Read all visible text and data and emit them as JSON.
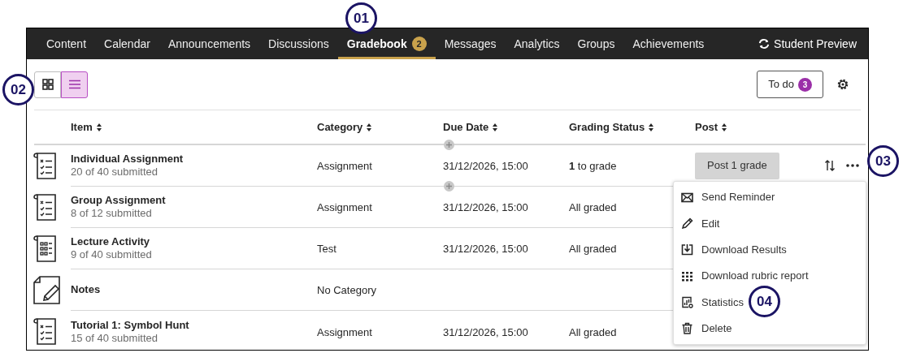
{
  "nav": {
    "tabs": [
      {
        "label": "Content",
        "selected": false
      },
      {
        "label": "Calendar",
        "selected": false
      },
      {
        "label": "Announcements",
        "selected": false
      },
      {
        "label": "Discussions",
        "selected": false
      },
      {
        "label": "Gradebook",
        "selected": true,
        "badge": "2"
      },
      {
        "label": "Messages",
        "selected": false
      },
      {
        "label": "Analytics",
        "selected": false
      },
      {
        "label": "Groups",
        "selected": false
      },
      {
        "label": "Achievements",
        "selected": false
      }
    ],
    "student_preview": "Student Preview"
  },
  "toolbar": {
    "views": [
      {
        "kind": "grid",
        "selected": false
      },
      {
        "kind": "list",
        "selected": true
      }
    ],
    "todo": {
      "label": "To do",
      "badge": "3"
    }
  },
  "table": {
    "columns": [
      "Item",
      "Category",
      "Due Date",
      "Grading Status",
      "Post"
    ],
    "rows": [
      {
        "kind": "checklist",
        "title": "Individual Assignment",
        "subtitle": "20 of 40 submitted",
        "category": "Assignment",
        "due": "31/12/2026, 15:00",
        "status": "**1** to grade",
        "post": "Post 1 grade",
        "add_above": true,
        "actions": true
      },
      {
        "kind": "checklist",
        "title": "Group Assignment",
        "subtitle": "8 of 12 submitted",
        "category": "Assignment",
        "due": "31/12/2026, 15:00",
        "status": "All graded",
        "add_above": true
      },
      {
        "kind": "test",
        "title": "Lecture Activity",
        "subtitle": "9 of 40 submitted",
        "category": "Test",
        "due": "31/12/2026, 15:00",
        "status": "All graded",
        "add_above": false
      },
      {
        "kind": "note",
        "title": "Notes",
        "category": "No Category",
        "add_above": false
      },
      {
        "kind": "checklist",
        "title": "Tutorial 1: Symbol Hunt",
        "subtitle": "15 of 40 submitted",
        "category": "Assignment",
        "due": "31/12/2026, 15:00",
        "status": "All graded",
        "add_above": false
      }
    ]
  },
  "menu": [
    {
      "kind": "envelope",
      "label": "Send Reminder"
    },
    {
      "kind": "pencil",
      "label": "Edit"
    },
    {
      "kind": "download",
      "label": "Download Results"
    },
    {
      "kind": "rubric",
      "label": "Download rubric report"
    },
    {
      "kind": "statistics",
      "label": "Statistics"
    },
    {
      "kind": "trash",
      "label": "Delete"
    }
  ],
  "callouts": [
    "01",
    "02",
    "03",
    "04"
  ]
}
